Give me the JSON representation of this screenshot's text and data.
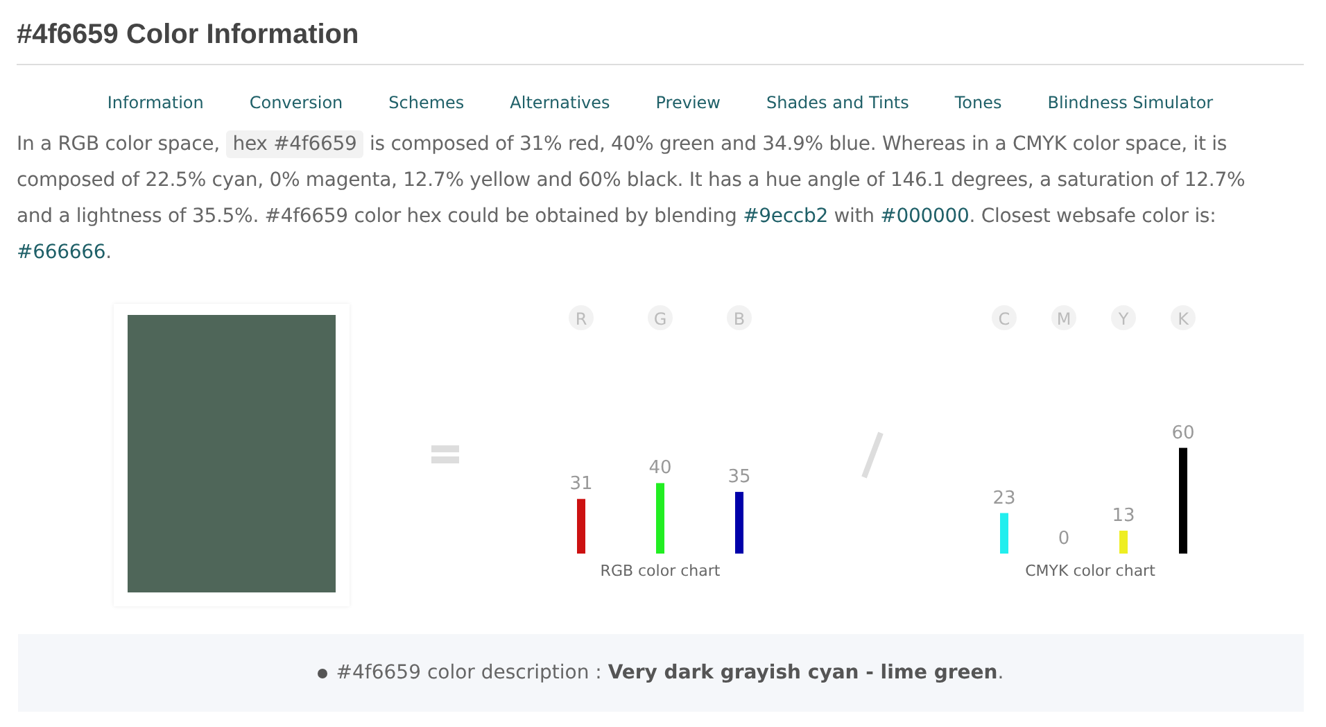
{
  "title": "#4f6659 Color Information",
  "nav": [
    {
      "label": "Information"
    },
    {
      "label": "Conversion"
    },
    {
      "label": "Schemes"
    },
    {
      "label": "Alternatives"
    },
    {
      "label": "Preview"
    },
    {
      "label": "Shades and Tints"
    },
    {
      "label": "Tones"
    },
    {
      "label": "Blindness Simulator"
    }
  ],
  "intro": [
    {
      "kind": "text",
      "text": "In a RGB color space, "
    },
    {
      "kind": "code",
      "text": "hex #4f6659"
    },
    {
      "kind": "text",
      "text": " is composed of 31% red, 40% green and 34.9% blue. Whereas in a CMYK color space, it is composed of 22.5% cyan, 0% magenta, 12.7% yellow and 60% black. It has a hue angle of 146.1 degrees, a saturation of 12.7% and a lightness of 35.5%. #4f6659 color hex could be obtained by blending "
    },
    {
      "kind": "link",
      "text": "#9eccb2"
    },
    {
      "kind": "text",
      "text": " with "
    },
    {
      "kind": "link",
      "text": "#000000"
    },
    {
      "kind": "text",
      "text": ". Closest websafe color is: "
    },
    {
      "kind": "link",
      "text": "#666666"
    },
    {
      "kind": "text",
      "text": "."
    }
  ],
  "swatch": {
    "color": "#4f6659"
  },
  "charts": [
    {
      "bars": [
        {
          "color": "#cc1111"
        },
        {
          "color": "#22ee22"
        },
        {
          "color": "#0000aa"
        }
      ],
      "chart_data": {
        "type": "bar",
        "title": "RGB color chart",
        "data_labels": true,
        "categories": [
          "R",
          "G",
          "B"
        ],
        "values": [
          31,
          40,
          35
        ]
      }
    },
    {
      "bars": [
        {
          "color": "#22eeee"
        },
        {
          "color": "#eeee22"
        },
        {
          "color": "#000000"
        }
      ],
      "chart_data": {
        "type": "bar",
        "title": "CMYK color chart",
        "data_labels": true,
        "categories": [
          "C",
          "M",
          "Y",
          "K"
        ],
        "values": [
          23,
          0,
          13,
          60
        ]
      }
    }
  ],
  "description": "#4f6659 color description : **Very dark grayish cyan - lime green**."
}
